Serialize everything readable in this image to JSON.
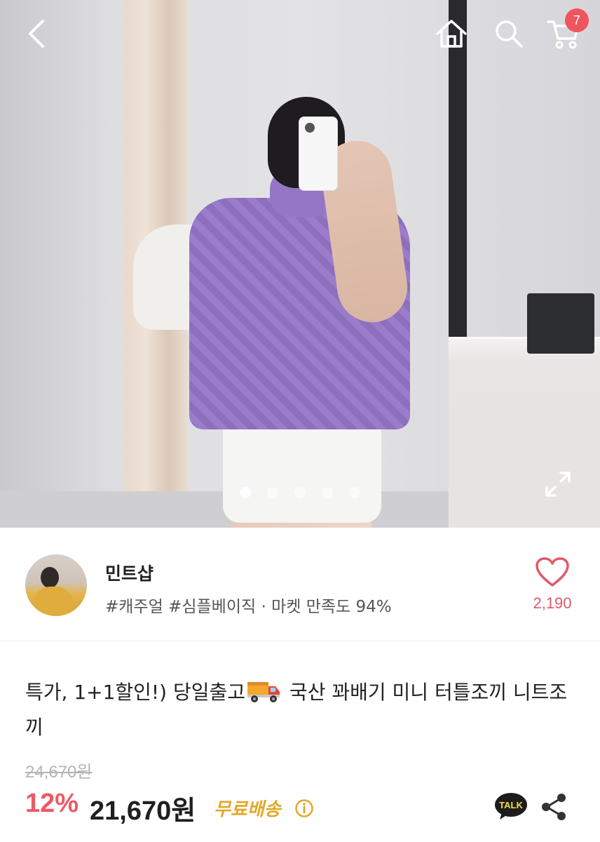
{
  "header": {
    "cart_count": "7"
  },
  "gallery": {
    "total_images": 5,
    "active_index": 0
  },
  "seller": {
    "name": "민트샵",
    "tags": "#캐주얼 #심플베이직 · 마켓 만족도 94%",
    "like_count": "2,190"
  },
  "product": {
    "title_before_emoji": "특가, 1+1할인!) 당일출고",
    "title_after_emoji": " 국산 꽈배기 미니 터틀조끼 니트조끼",
    "original_price": "24,670원",
    "discount_rate": "12%",
    "sale_price": "21,670원",
    "shipping_label": "무료배송"
  },
  "colors": {
    "accent_red": "#ec5a66",
    "shipping_orange": "#e4a72a",
    "badge_red": "#f0545c"
  },
  "icons": [
    "back-icon",
    "home-icon",
    "search-icon",
    "cart-icon",
    "expand-icon",
    "heart-icon",
    "truck-emoji",
    "info-icon",
    "kakaotalk-icon",
    "share-icon"
  ]
}
